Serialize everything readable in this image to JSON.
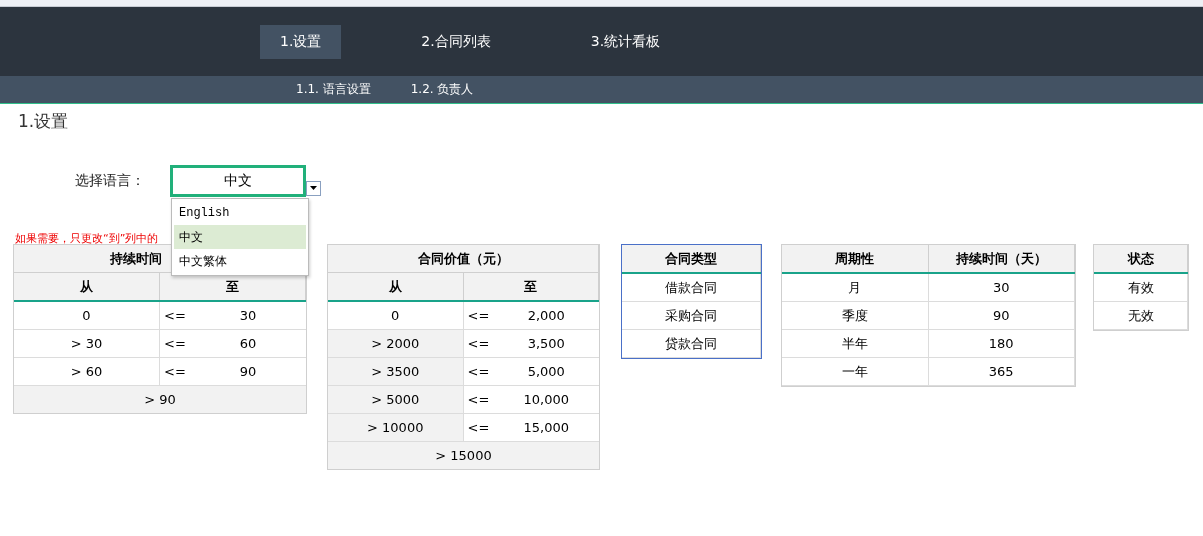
{
  "nav_tabs": [
    {
      "label": "1.设置",
      "selected": true
    },
    {
      "label": "2.合同列表",
      "selected": false
    },
    {
      "label": "3.统计看板",
      "selected": false
    }
  ],
  "sub_tabs": [
    {
      "label": "1.1. 语言设置"
    },
    {
      "label": "1.2. 负责人"
    }
  ],
  "page_title": "1.设置",
  "language": {
    "label": "选择语言：",
    "value": "中文",
    "options": [
      {
        "label": "English",
        "selected": false
      },
      {
        "label": "中文",
        "selected": true
      },
      {
        "label": "中文繁体",
        "selected": false
      }
    ]
  },
  "note": "如果需要，只更改“到”列中的",
  "tables": [
    {
      "kind": "range",
      "title": "持续时间",
      "selected": false,
      "columns": [
        "从",
        "至"
      ],
      "rows": [
        {
          "from": "0",
          "op": "<=",
          "to": "30"
        },
        {
          "from": "> 30",
          "op": "<=",
          "to": "60"
        },
        {
          "from": "> 60",
          "op": "<=",
          "to": "90"
        }
      ],
      "footer": "> 90"
    },
    {
      "kind": "range",
      "title": "合同价值（元）",
      "selected": false,
      "columns": [
        "从",
        "至"
      ],
      "rows": [
        {
          "from": "0",
          "op": "<=",
          "to": "2,000"
        },
        {
          "from": "> 2000",
          "op": "<=",
          "to": "3,500"
        },
        {
          "from": "> 3500",
          "op": "<=",
          "to": "5,000"
        },
        {
          "from": "> 5000",
          "op": "<=",
          "to": "10,000"
        },
        {
          "from": "> 10000",
          "op": "<=",
          "to": "15,000"
        }
      ],
      "footer": "> 15000"
    },
    {
      "kind": "list",
      "selected": true,
      "columns": [
        "合同类型"
      ],
      "rows": [
        [
          "借款合同"
        ],
        [
          "采购合同"
        ],
        [
          "贷款合同"
        ]
      ]
    },
    {
      "kind": "list",
      "selected": false,
      "columns": [
        "周期性",
        "持续时间（天）"
      ],
      "rows": [
        [
          "月",
          "30"
        ],
        [
          "季度",
          "90"
        ],
        [
          "半年",
          "180"
        ],
        [
          "一年",
          "365"
        ]
      ]
    },
    {
      "kind": "list",
      "selected": false,
      "columns": [
        "状态"
      ],
      "rows": [
        [
          "有效"
        ],
        [
          "无效"
        ]
      ]
    }
  ]
}
